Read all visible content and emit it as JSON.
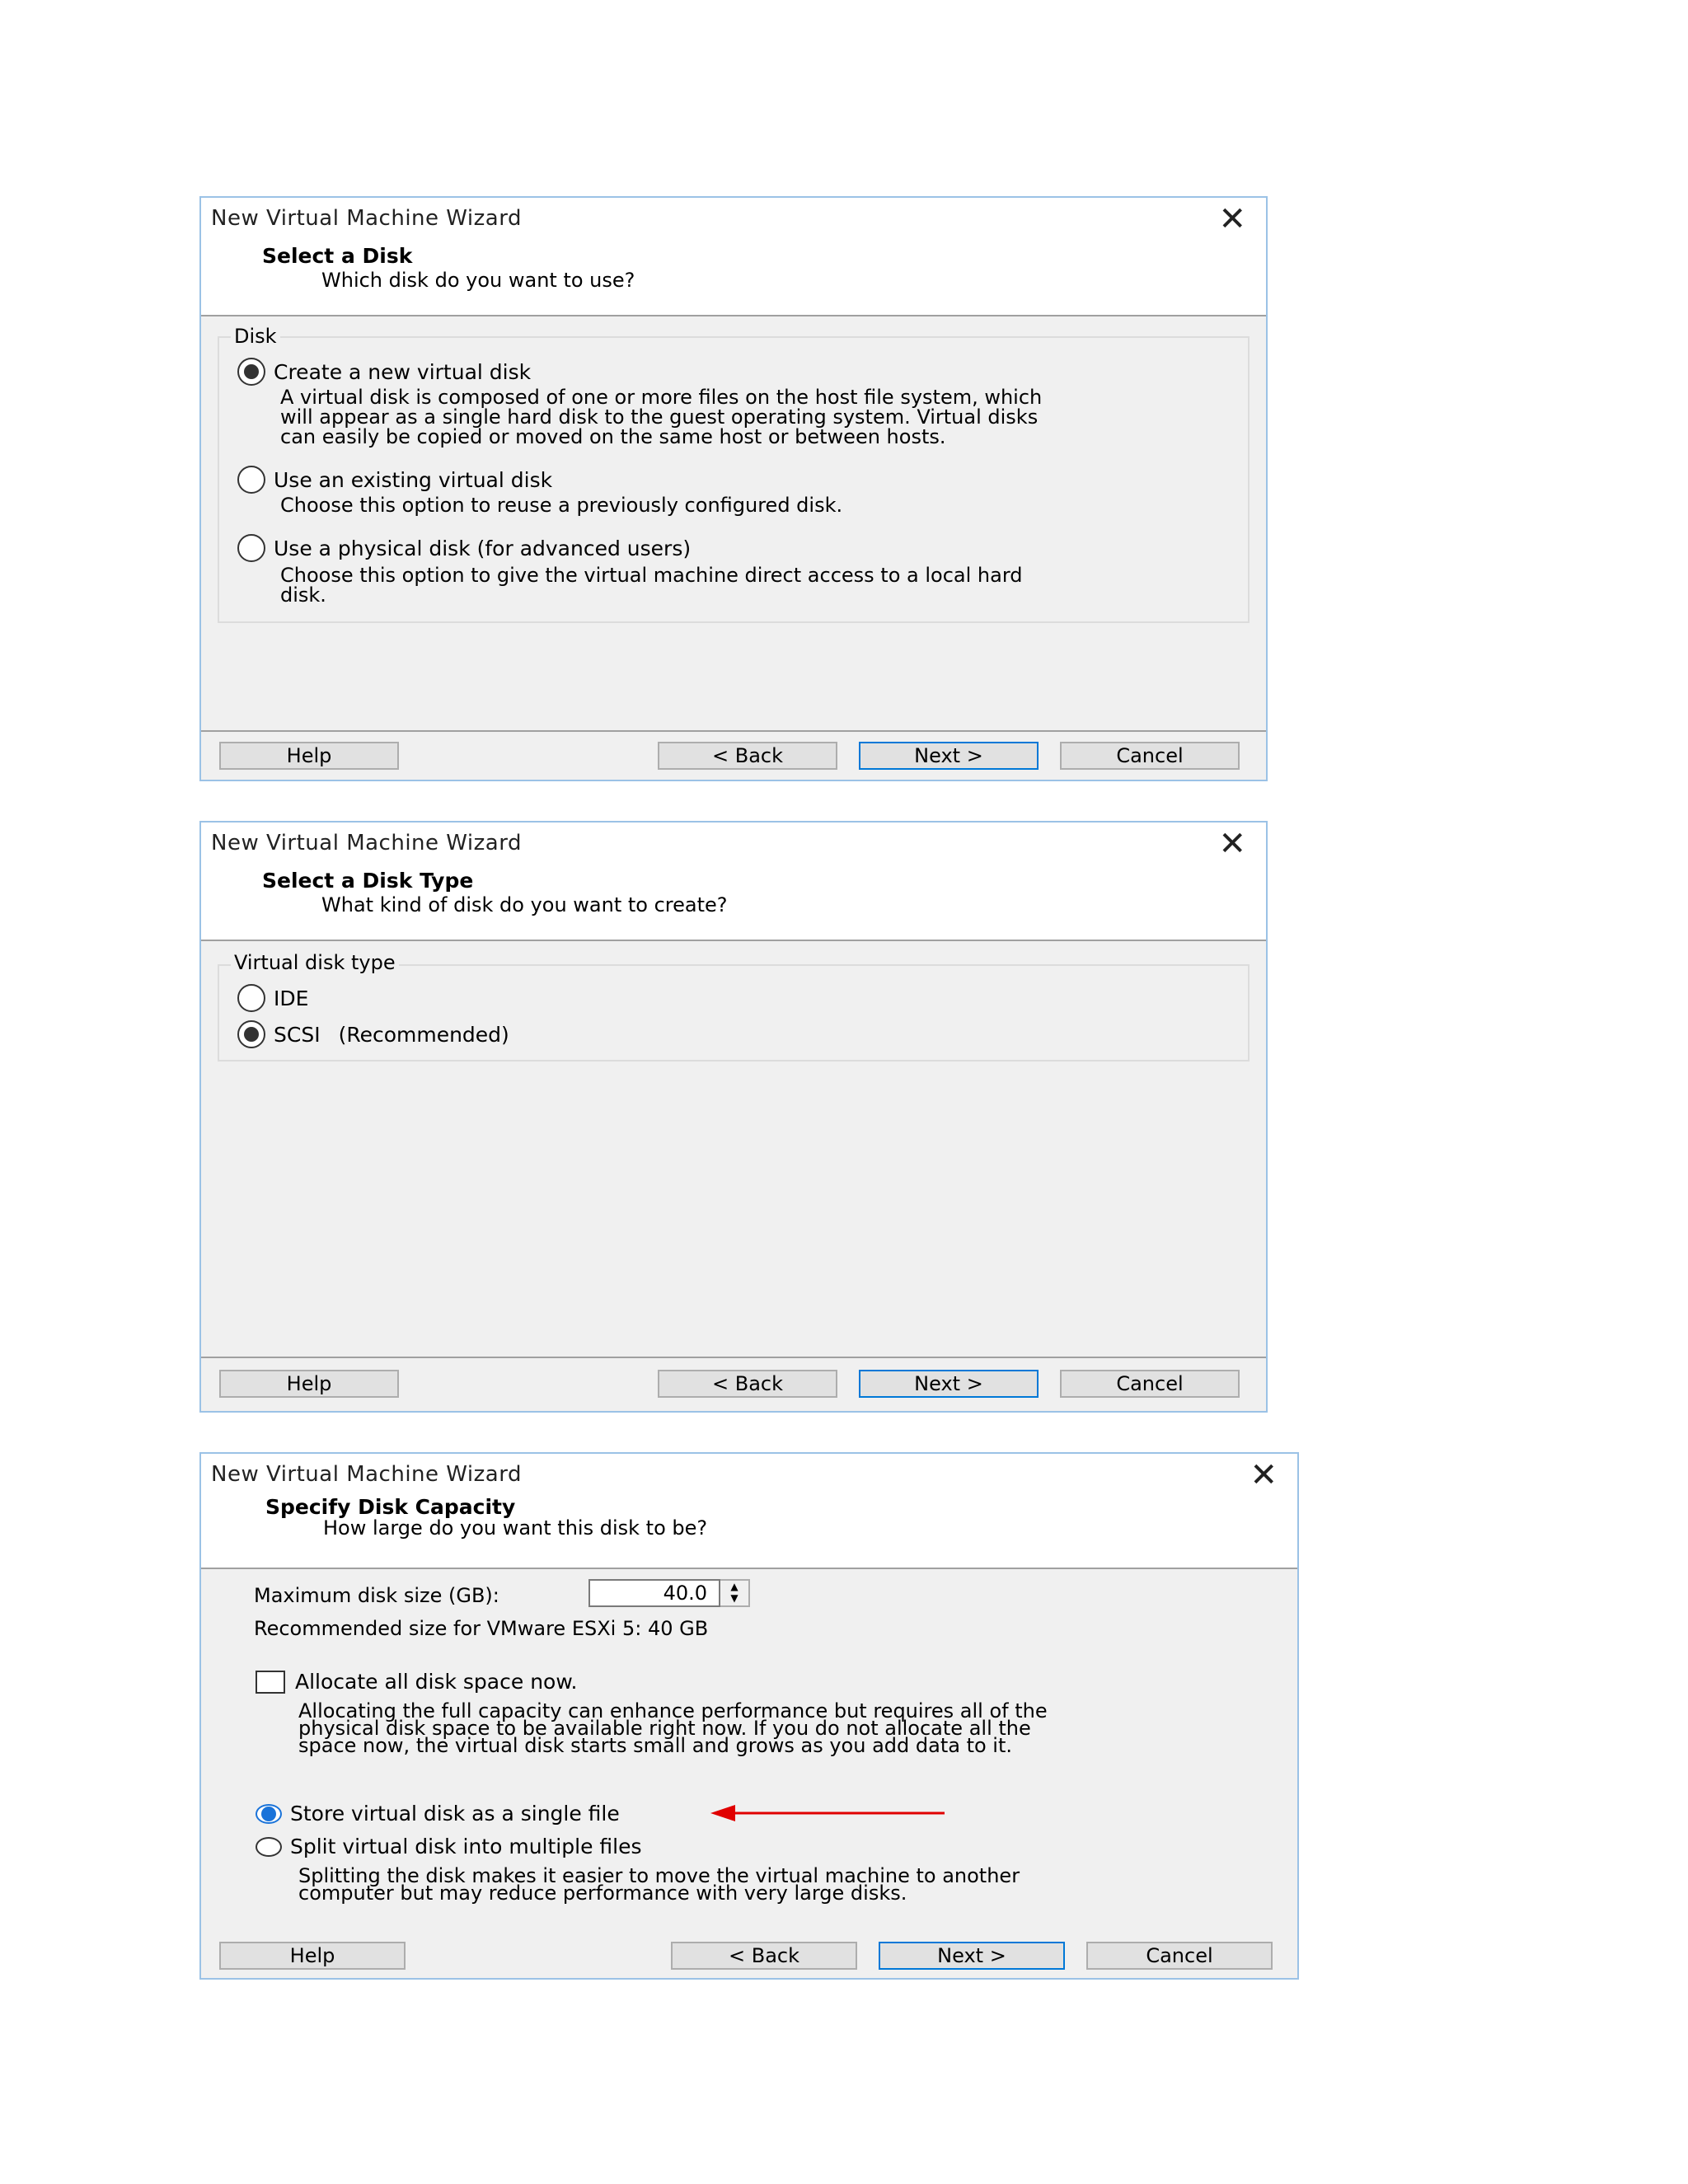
{
  "dialog1": {
    "window_title": "New Virtual Machine Wizard",
    "page_title": "Select a Disk",
    "page_subtitle": "Which disk do you want to use?",
    "group_label": "Disk",
    "options": [
      {
        "label": "Create a new virtual disk",
        "selected": true,
        "desc": [
          "A virtual disk is composed of one or more files on the host file system, which",
          "will appear as a single hard disk to the guest operating system. Virtual disks",
          "can easily be copied or moved on the same host or between hosts."
        ]
      },
      {
        "label": "Use an existing virtual disk",
        "selected": false,
        "desc": [
          "Choose this option to reuse a previously configured disk."
        ]
      },
      {
        "label": "Use a physical disk (for advanced users)",
        "selected": false,
        "desc": [
          "Choose this option to give the virtual machine direct access to a local hard",
          "disk."
        ]
      }
    ],
    "buttons": {
      "help": "Help",
      "back": "< Back",
      "next": "Next >",
      "cancel": "Cancel"
    }
  },
  "dialog2": {
    "window_title": "New Virtual Machine Wizard",
    "page_title": "Select a Disk Type",
    "page_subtitle": "What kind of disk do you want to create?",
    "group_label": "Virtual disk type",
    "options": [
      {
        "label": "IDE",
        "selected": false
      },
      {
        "label": "SCSI",
        "note": "(Recommended)",
        "selected": true
      }
    ],
    "buttons": {
      "help": "Help",
      "back": "< Back",
      "next": "Next >",
      "cancel": "Cancel"
    }
  },
  "dialog3": {
    "window_title": "New Virtual Machine Wizard",
    "page_title": "Specify Disk Capacity",
    "page_subtitle": "How large do you want this disk to be?",
    "max_size_label": "Maximum disk size (GB):",
    "max_size_value": "40.0",
    "recommended": "Recommended size for VMware ESXi 5: 40 GB",
    "allocate_label": "Allocate all disk space now.",
    "allocate_checked": false,
    "allocate_desc": [
      "Allocating the full capacity can enhance performance but requires all of the",
      "physical disk space to be available right now. If you do not allocate all the",
      "space now, the virtual disk starts small and grows as you add data to it."
    ],
    "store_single_label": "Store virtual disk as a single file",
    "store_single_selected": true,
    "split_label": "Split virtual disk into multiple files",
    "split_desc": [
      "Splitting the disk makes it easier to move the virtual machine to another",
      "computer but may reduce performance with very large disks."
    ],
    "annotation_arrow_color": "#e00000",
    "buttons": {
      "help": "Help",
      "back": "< Back",
      "next": "Next >",
      "cancel": "Cancel"
    }
  }
}
